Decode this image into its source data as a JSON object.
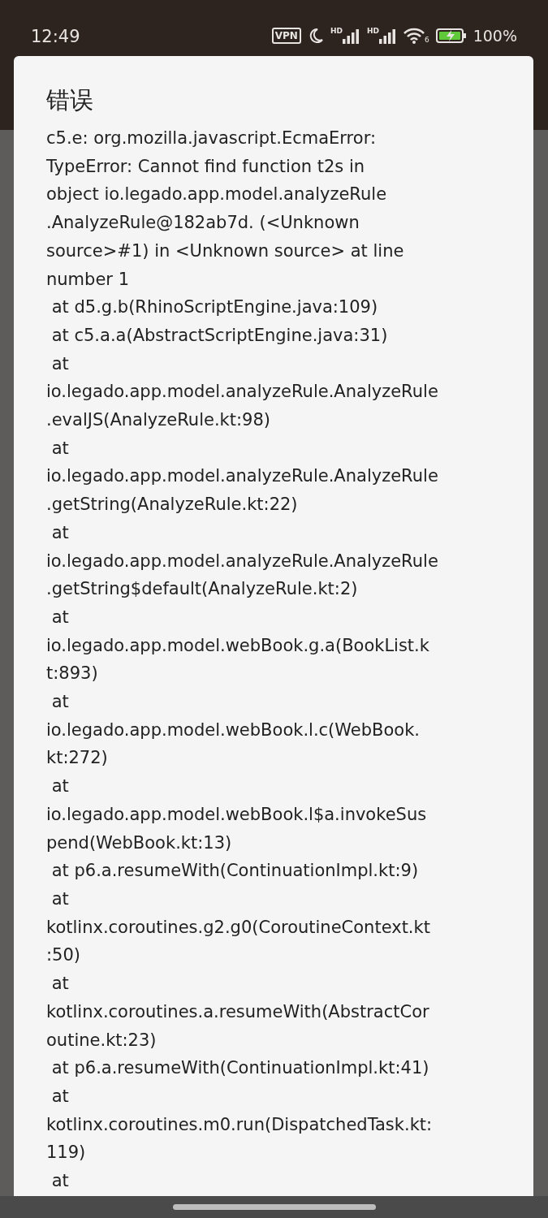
{
  "status_bar": {
    "time": "12:49",
    "vpn": "VPN",
    "signal_label_1": "HD",
    "signal_label_2": "HD",
    "wifi_label": "6",
    "battery": "100%"
  },
  "dialog": {
    "title": "错误",
    "message_lines": [
      "c5.e: org.mozilla.javascript.EcmaError:",
      "TypeError: Cannot find function t2s in",
      "object io.legado.app.model.analyzeRule",
      ".AnalyzeRule@182ab7d. (<Unknown",
      "source>#1) in <Unknown source> at line",
      "number 1",
      " at d5.g.b(RhinoScriptEngine.java:109)",
      " at c5.a.a(AbstractScriptEngine.java:31)",
      " at",
      "io.legado.app.model.analyzeRule.AnalyzeRule",
      ".evalJS(AnalyzeRule.kt:98)",
      " at",
      "io.legado.app.model.analyzeRule.AnalyzeRule",
      ".getString(AnalyzeRule.kt:22)",
      " at",
      "io.legado.app.model.analyzeRule.AnalyzeRule",
      ".getString$default(AnalyzeRule.kt:2)",
      " at",
      "io.legado.app.model.webBook.g.a(BookList.k",
      "t:893)",
      " at",
      "io.legado.app.model.webBook.l.c(WebBook.",
      "kt:272)",
      " at",
      "io.legado.app.model.webBook.l$a.invokeSus",
      "pend(WebBook.kt:13)",
      " at p6.a.resumeWith(ContinuationImpl.kt:9)",
      " at",
      "kotlinx.coroutines.g2.g0(CoroutineContext.kt",
      ":50)",
      " at",
      "kotlinx.coroutines.a.resumeWith(AbstractCor",
      "outine.kt:23)",
      " at p6.a.resumeWith(ContinuationImpl.kt:41)",
      " at",
      "kotlinx.coroutines.m0.run(DispatchedTask.kt:",
      "119)",
      " at"
    ]
  }
}
